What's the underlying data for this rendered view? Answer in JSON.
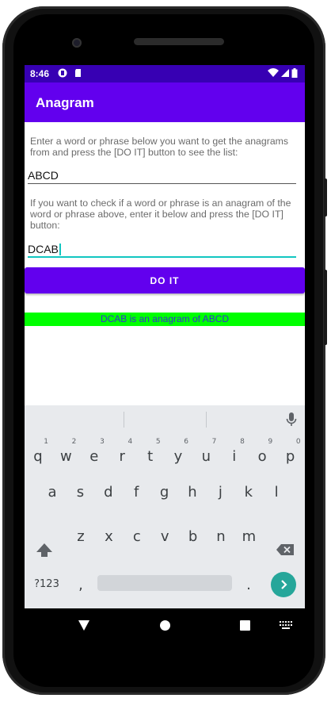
{
  "status_bar": {
    "time": "8:46"
  },
  "app_bar": {
    "title": "Anagram"
  },
  "form": {
    "hint_1": "Enter a word or phrase below you want to get the anagrams from and press the [DO IT] button to see the list:",
    "input_1_value": "ABCD",
    "hint_2": "If you want to check if a word or phrase is an anagram of the word or phrase above, enter it below and press the [DO IT] button:",
    "input_2_value": "DCAB",
    "button_label": "DO IT",
    "result_text": "DCAB is an anagram of ABCD"
  },
  "keyboard": {
    "row1": [
      {
        "ch": "q",
        "num": "1"
      },
      {
        "ch": "w",
        "num": "2"
      },
      {
        "ch": "e",
        "num": "3"
      },
      {
        "ch": "r",
        "num": "4"
      },
      {
        "ch": "t",
        "num": "5"
      },
      {
        "ch": "y",
        "num": "6"
      },
      {
        "ch": "u",
        "num": "7"
      },
      {
        "ch": "i",
        "num": "8"
      },
      {
        "ch": "o",
        "num": "9"
      },
      {
        "ch": "p",
        "num": "0"
      }
    ],
    "row2": [
      "a",
      "s",
      "d",
      "f",
      "g",
      "h",
      "j",
      "k",
      "l"
    ],
    "row3": [
      "z",
      "x",
      "c",
      "v",
      "b",
      "n",
      "m"
    ],
    "symbols_label": "?123",
    "comma": ",",
    "period": "."
  },
  "colors": {
    "status_bar": "#3700b3",
    "primary": "#6200ee",
    "accent": "#12c6c1",
    "result_bg": "#00ff00",
    "result_text": "#3333cc",
    "enter_key": "#26a69a"
  },
  "icons": [
    "lock-icon",
    "sd-card-icon",
    "wifi-icon",
    "signal-icon",
    "battery-icon",
    "mic-icon",
    "shift-icon",
    "backspace-icon",
    "enter-arrow-icon",
    "back-nav-icon",
    "home-nav-icon",
    "recents-nav-icon",
    "keyboard-switch-icon"
  ]
}
